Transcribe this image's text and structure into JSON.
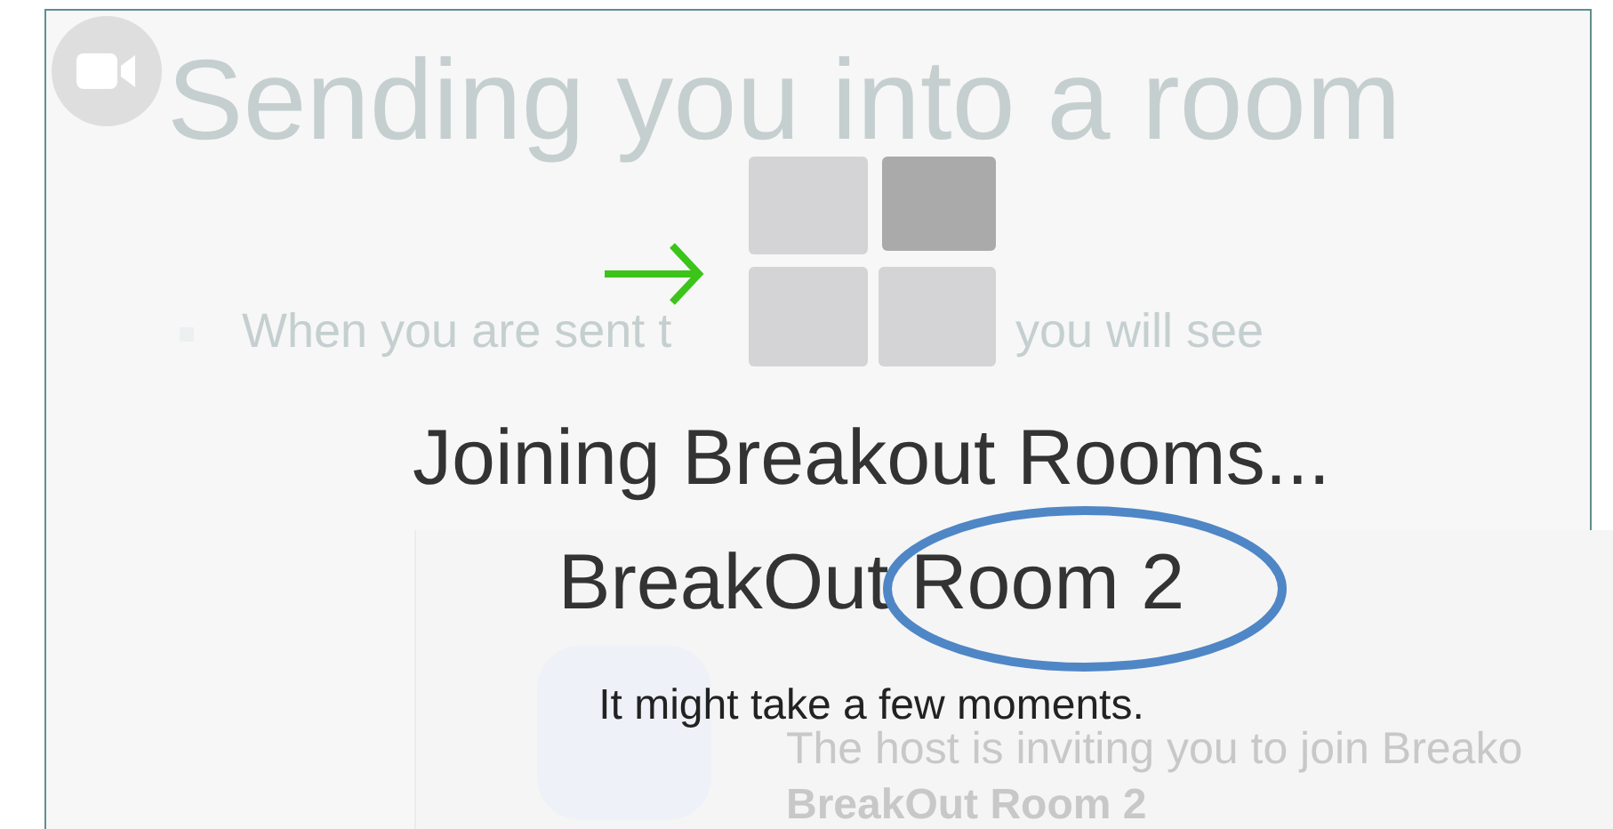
{
  "slide": {
    "title": "Sending you into a room",
    "bullet_parts": [
      "When you are sent t",
      "you will see"
    ]
  },
  "dialog": {
    "message": "The host is inviting you to join Breako",
    "room": "BreakOut Room 2"
  },
  "overlay": {
    "heading": "Joining Breakout Rooms...",
    "room": "BreakOut Room 2",
    "note": "It might take a few moments."
  }
}
